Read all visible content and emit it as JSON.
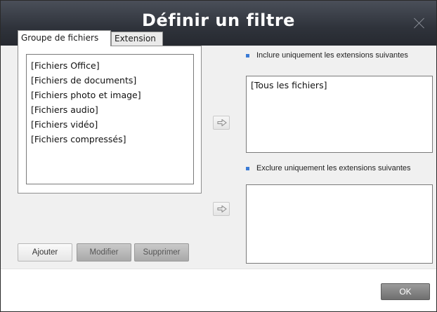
{
  "dialog": {
    "title": "Définir un filtre"
  },
  "tabs": [
    {
      "label": "Groupe de fichiers",
      "active": true
    },
    {
      "label": "Extension",
      "active": false
    }
  ],
  "file_groups": [
    "[Fichiers Office]",
    "[Fichiers de documents]",
    "[Fichiers photo et image]",
    "[Fichiers audio]",
    "[Fichiers vidéo]",
    "[Fichiers compressés]"
  ],
  "buttons": {
    "add": "Ajouter",
    "modify": "Modifier",
    "delete": "Supprimer",
    "ok": "OK"
  },
  "include": {
    "label": "Inclure uniquement les extensions suivantes",
    "items": [
      "[Tous les fichiers]"
    ]
  },
  "exclude": {
    "label": "Exclure uniquement les extensions suivantes",
    "items": []
  },
  "icons": {
    "close": "close-icon",
    "arrow": "arrow-right-icon"
  },
  "colors": {
    "titlebar": "#2f333b",
    "bullet": "#3a7bd5",
    "content_bg": "#f0f0f0"
  }
}
